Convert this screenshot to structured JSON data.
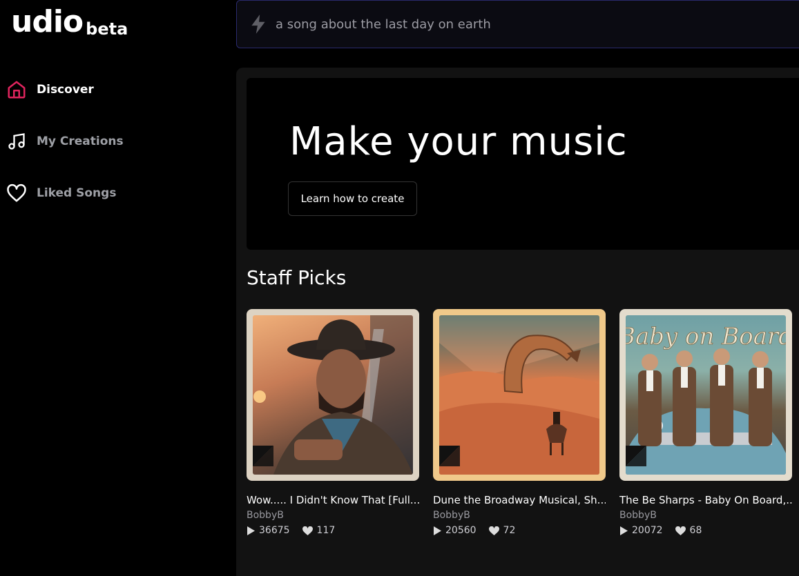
{
  "brand": {
    "name": "udio",
    "tag": "beta"
  },
  "search": {
    "placeholder": "a song about the last day on earth"
  },
  "sidebar": {
    "items": [
      {
        "label": "Discover",
        "icon": "home-icon",
        "active": true
      },
      {
        "label": "My Creations",
        "icon": "music-note-icon",
        "active": false
      },
      {
        "label": "Liked Songs",
        "icon": "heart-icon",
        "active": false
      }
    ]
  },
  "hero": {
    "title": "Make your music",
    "button_label": "Learn how to create"
  },
  "staff_picks": {
    "title": "Staff Picks",
    "cards": [
      {
        "title": "Wow..... I Didn't Know That [Full...",
        "artist": "BobbyB",
        "plays": "36675",
        "likes": "117"
      },
      {
        "title": "Dune the Broadway Musical, Sh...",
        "artist": "BobbyB",
        "plays": "20560",
        "likes": "72"
      },
      {
        "title": "The Be Sharps - Baby On Board,...",
        "artist": "BobbyB",
        "plays": "20072",
        "likes": "68",
        "art_text": "Baby on Board"
      }
    ]
  },
  "colors": {
    "accent": "#e0245e",
    "background": "#000000",
    "panel": "#121212",
    "search_border": "#2a2a6e"
  }
}
